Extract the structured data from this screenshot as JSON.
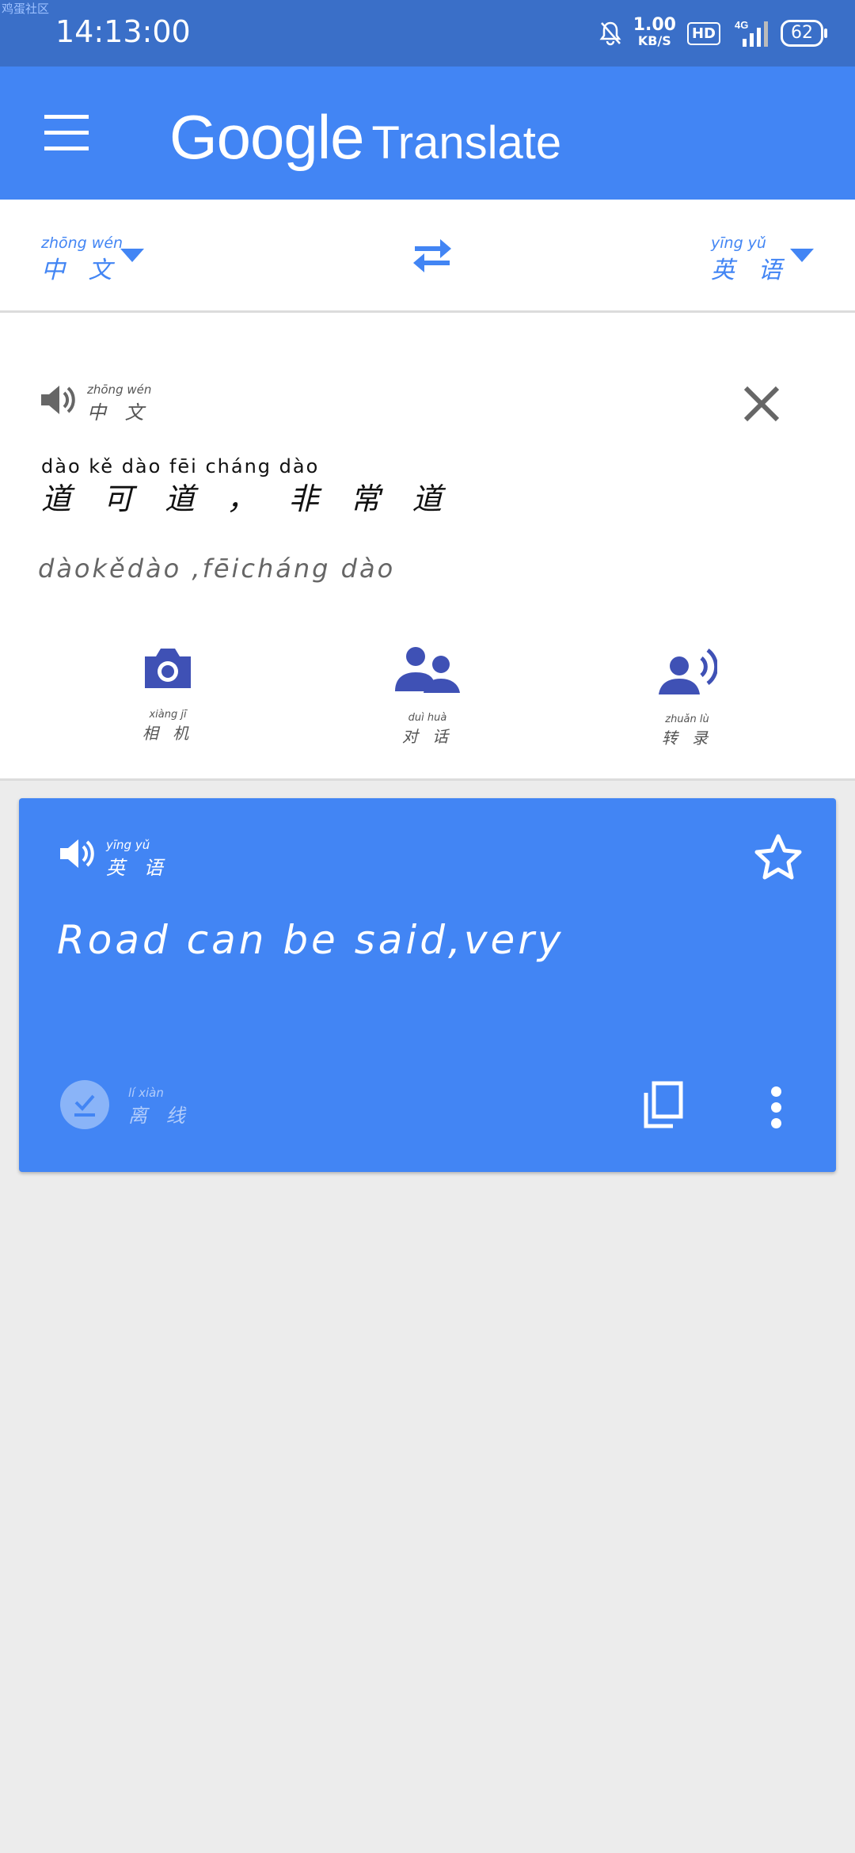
{
  "status_bar": {
    "watermark": "鸡蛋社区",
    "time": "14:13:00",
    "net_speed": "1.00",
    "net_unit": "KB/S",
    "hd": "HD",
    "network": "4G",
    "battery": "62"
  },
  "app_bar": {
    "logo_google": "Google",
    "logo_translate": "Translate"
  },
  "language_bar": {
    "source_language_pinyin": "zhōng wén",
    "source_language": "中 文",
    "target_language_pinyin": "yīng yǔ",
    "target_language": "英 语"
  },
  "input": {
    "language_pinyin": "zhōng wén",
    "language": "中 文",
    "source_pinyin": "dào  kě  dào      fēi  cháng  dào",
    "source_text": "道 可 道 ，  非 常 道",
    "romanization": "dàokědào ,fēicháng dào",
    "tools": [
      {
        "pinyin": "xiàng  jī",
        "label": "相 机"
      },
      {
        "pinyin": "duì  huà",
        "label": "对 话"
      },
      {
        "pinyin": "zhuǎn  lù",
        "label": "转 录"
      }
    ]
  },
  "result": {
    "language_pinyin": "yīng  yǔ",
    "language": "英 语",
    "translation": "Road can be said,very",
    "offline_pinyin": "lí  xiàn",
    "offline_label": "离 线"
  },
  "colors": {
    "status_bar": "#3a6fc8",
    "primary": "#4285f4",
    "background": "#ececec",
    "icon_indigo": "#3f51b5"
  }
}
